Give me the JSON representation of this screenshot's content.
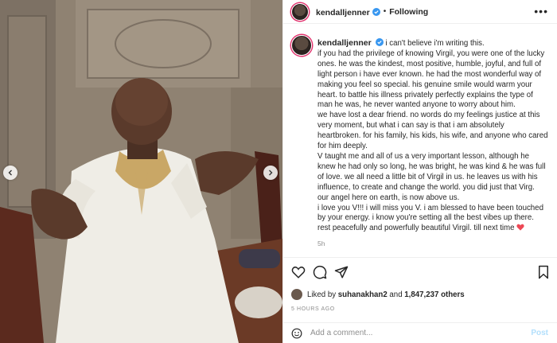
{
  "post": {
    "username": "kendalljenner",
    "follow_state": "Following",
    "dot": "•",
    "more_icon": "more-horizontal-icon",
    "verified_color": "#3897f0",
    "caption_first": "i can't believe i'm writing this.",
    "caption_lines": [
      "if you had the privilege of knowing Virgil, you were one of the lucky",
      "ones. he was the kindest, most positive, humble, joyful, and full of",
      "light person i have ever known. he had the most wonderful way of",
      "making you feel so special. his genuine smile would warm your",
      "heart. to battle his illness privately perfectly explains the type of",
      "man he was, he never wanted anyone to worry about him.",
      "we have lost a dear friend. no words do my feelings justice at this",
      "very moment, but what i can say is that i am absolutely",
      "heartbroken. for his family, his kids, his wife, and anyone who cared",
      "for him deeply.",
      "V taught me and all of us a very important lesson, although he",
      "knew he had only so long, he was bright, he was kind & he was full",
      "of love. we all need a little bit of Virgil in us. he leaves us with his",
      "influence, to create and change the world. you did just that Virg.",
      "our angel here on earth, is now above us.",
      "i love you V!!! i will miss you V. i am blessed to have been touched",
      "by your energy. i know you're setting all the best vibes up there.",
      "rest peacefully and powerfully beautiful Virgil. till next time"
    ],
    "time_ago": "5h",
    "likes_prefix": "Liked by",
    "liked_by_user": "suhanakhan2",
    "likes_joiner": "and",
    "likes_count": "1,847,237 others",
    "timestamp": "5 HOURS AGO",
    "comment_placeholder": "Add a comment...",
    "post_button": "Post",
    "heart_color": "#ed4956",
    "post_button_color": "#b2dffc"
  }
}
